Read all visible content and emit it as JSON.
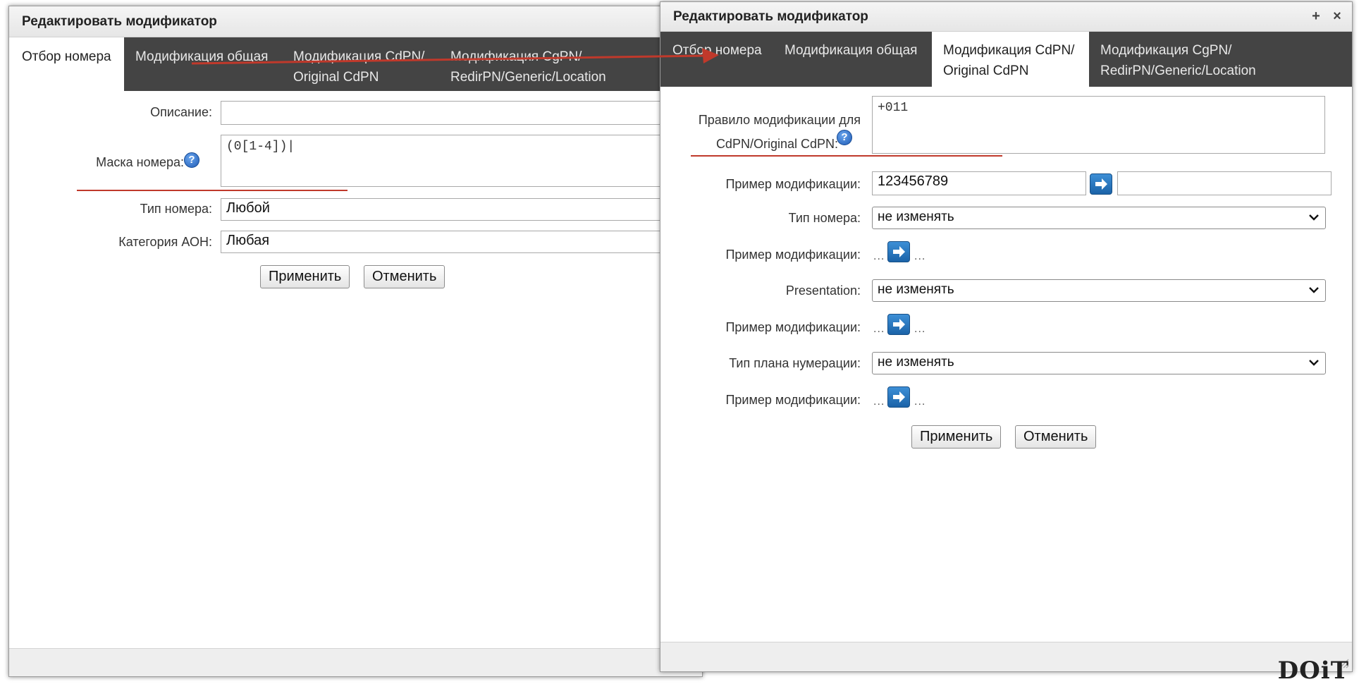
{
  "left_dialog": {
    "title": "Редактировать модификатор",
    "tabs": [
      {
        "label": "Отбор номера"
      },
      {
        "label_line1": "Модификация общая"
      },
      {
        "label_line1": "Модификация CdPN/",
        "label_line2": "Original CdPN"
      },
      {
        "label_line1": "Модификация CgPN/",
        "label_line2": "RedirPN/Generic/Location"
      }
    ],
    "description_label": "Описание:",
    "description_value": "",
    "mask_label": "Маска номера:",
    "mask_value": "(0[1-4])|",
    "number_type_label": "Тип номера:",
    "number_type_value": "Любой",
    "aon_label": "Категория АОН:",
    "aon_value": "Любая",
    "apply_label": "Применить",
    "cancel_label": "Отменить"
  },
  "right_dialog": {
    "title": "Редактировать модификатор",
    "plus_glyph": "+",
    "close_glyph": "×",
    "tabs": [
      {
        "label": "Отбор номера"
      },
      {
        "label": "Модификация общая"
      },
      {
        "label_line1": "Модификация CdPN/",
        "label_line2": "Original CdPN"
      },
      {
        "label_line1": "Модификация CgPN/",
        "label_line2": "RedirPN/Generic/Location"
      }
    ],
    "rule_label_line1": "Правило модификации для",
    "rule_label_line2": "CdPN/Original CdPN:",
    "rule_value": "+011",
    "example_label": "Пример модификации:",
    "example_input": "123456789",
    "example_output": "",
    "number_type_label": "Тип номера:",
    "number_type_value": "не изменять",
    "dots": "...",
    "presentation_label": "Presentation:",
    "presentation_value": "не изменять",
    "numbering_plan_label": "Тип плана нумерации:",
    "numbering_plan_value": "не изменять",
    "apply_label": "Применить",
    "cancel_label": "Отменить"
  },
  "help_glyph": "?",
  "accent_color": "#c0392b",
  "tab_bar_color": "#444444",
  "watermark_text": "DOiT"
}
